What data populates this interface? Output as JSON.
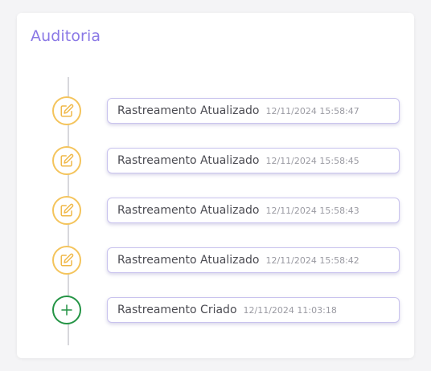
{
  "panel": {
    "title": "Auditoria"
  },
  "entries": [
    {
      "type": "edit",
      "title": "Rastreamento Atualizado",
      "timestamp": "12/11/2024 15:58:47"
    },
    {
      "type": "edit",
      "title": "Rastreamento Atualizado",
      "timestamp": "12/11/2024 15:58:45"
    },
    {
      "type": "edit",
      "title": "Rastreamento Atualizado",
      "timestamp": "12/11/2024 15:58:43"
    },
    {
      "type": "edit",
      "title": "Rastreamento Atualizado",
      "timestamp": "12/11/2024 15:58:42"
    },
    {
      "type": "add",
      "title": "Rastreamento Criado",
      "timestamp": "12/11/2024 11:03:18"
    }
  ],
  "icons": {
    "edit": "edit-icon",
    "add": "plus-icon"
  },
  "colors": {
    "title": "#8a78e6",
    "edit": "#f4c45c",
    "add": "#249445",
    "entry_border": "#c9c3ee"
  }
}
